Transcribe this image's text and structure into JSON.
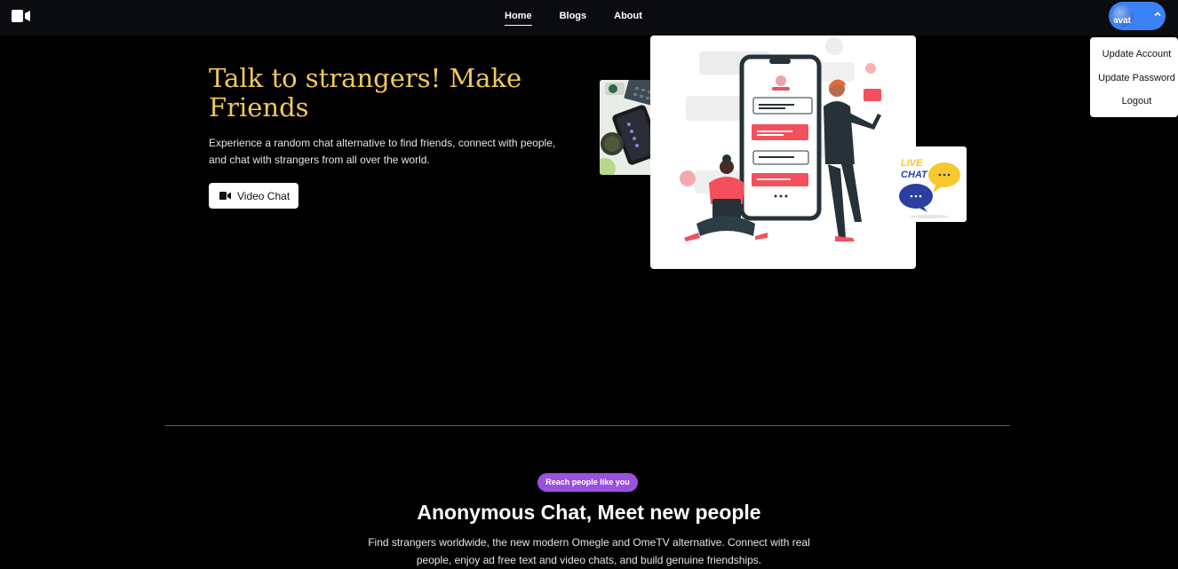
{
  "nav": {
    "links": [
      {
        "label": "Home",
        "active": true
      },
      {
        "label": "Blogs",
        "active": false
      },
      {
        "label": "About",
        "active": false
      }
    ],
    "avatar_text": "avat"
  },
  "user_menu": {
    "items": [
      "Update Account",
      "Update Password",
      "Logout"
    ]
  },
  "hero": {
    "title": "Talk to strangers! Make Friends",
    "description": "Experience a random chat alternative to find friends, connect with people, and chat with strangers from all over the world.",
    "cta_label": "Video Chat"
  },
  "illustration": {
    "live_chat_text_1": "LIVE",
    "live_chat_text_2": "CHAT"
  },
  "section": {
    "badge": "Reach people like you",
    "title": "Anonymous Chat, Meet new people",
    "description": "Find strangers worldwide, the new modern Omegle and OmeTV alternative. Connect with real people, enjoy ad free text and video chats, and build genuine friendships."
  },
  "colors": {
    "accent_gold": "#f0c95a",
    "brand_blue": "#3b82f6",
    "badge_purple": "#9b51e0",
    "nav_bg": "#0b0c0f"
  }
}
